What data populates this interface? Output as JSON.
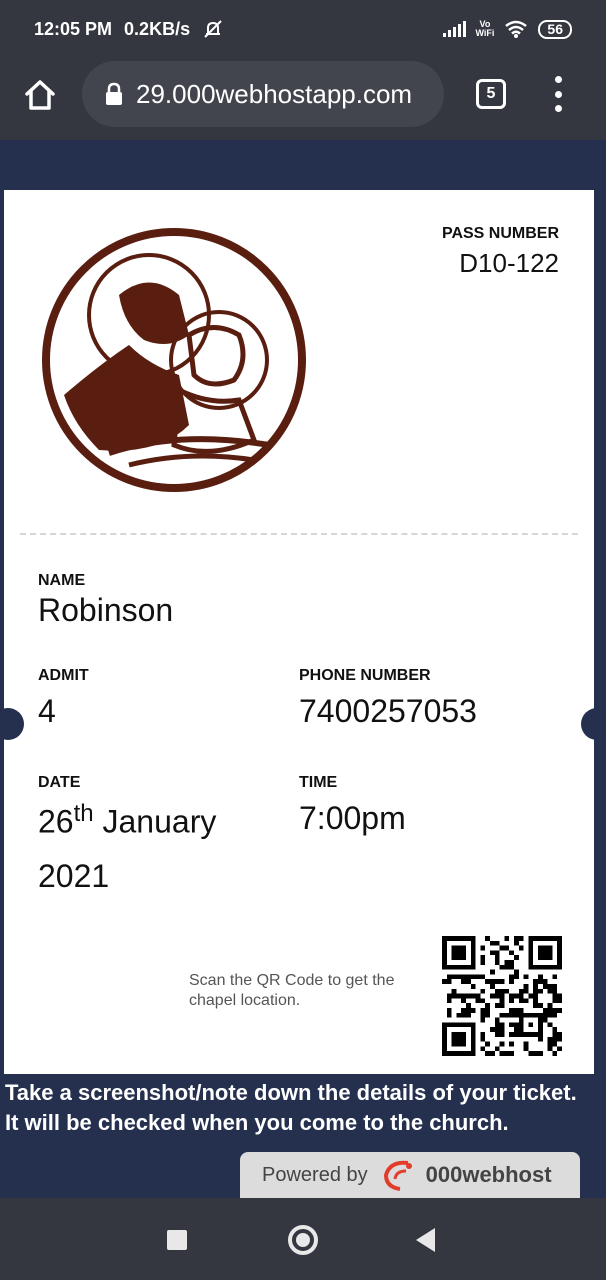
{
  "status_bar": {
    "time": "12:05 PM",
    "speed": "0.2KB/s",
    "vowifi_top": "Vo",
    "vowifi_bottom": "WiFi",
    "battery": "56"
  },
  "browser": {
    "url": "29.000webhostapp.com",
    "tab_count": "5"
  },
  "ticket": {
    "pass_number_label": "PASS NUMBER",
    "pass_number": "D10-122",
    "name_label": "NAME",
    "name": "Robinson",
    "admit_label": "ADMIT",
    "admit": "4",
    "phone_label": "PHONE NUMBER",
    "phone": "7400257053",
    "date_label": "DATE",
    "date_day": "26",
    "date_suffix": "th",
    "date_month": "January",
    "date_year": "2021",
    "time_label": "TIME",
    "time": "7:00pm",
    "scan_text": "Scan the QR Code to get the chapel location."
  },
  "note": {
    "line1": "Take a screenshot/note down the details of your ticket.",
    "line2": "It will be checked when you come to the church."
  },
  "footer": {
    "powered_by": "Powered by",
    "brand": "000webhost"
  },
  "colors": {
    "page_bg": "#24304e",
    "system_bar": "#343740",
    "logo_brown": "#5a1e10"
  }
}
